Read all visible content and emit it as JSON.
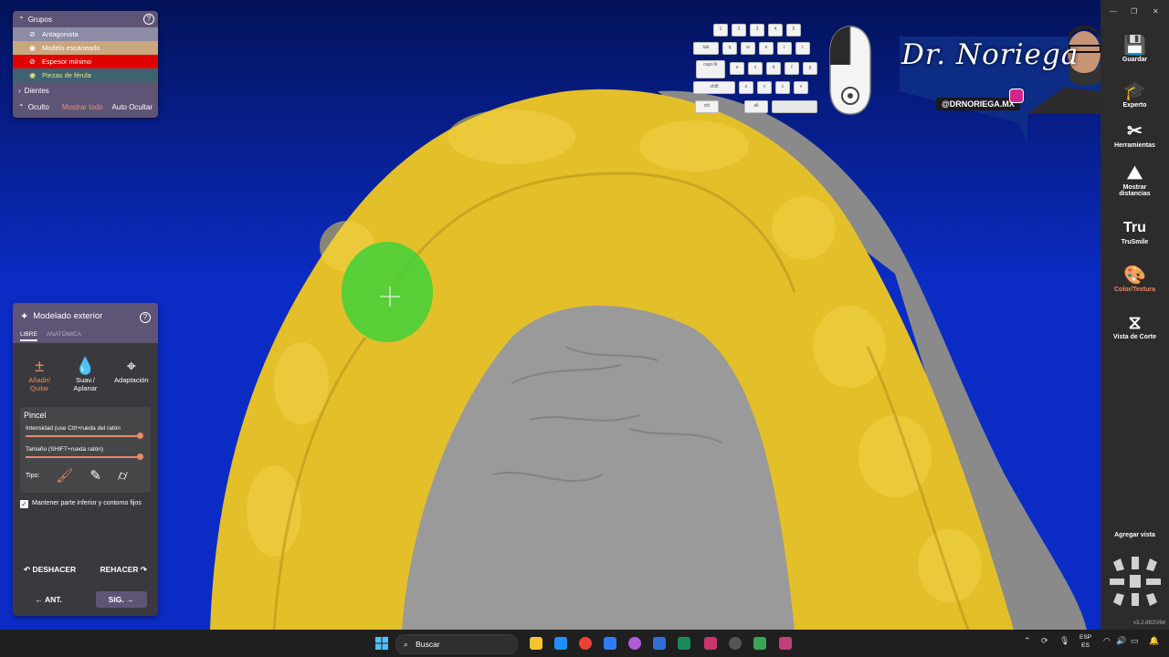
{
  "groups_panel": {
    "title": "Grupos",
    "rows": [
      {
        "label": "Antagonista"
      },
      {
        "label": "Modelo escaneado"
      },
      {
        "label": "Espesor mínimo"
      },
      {
        "label": "Piezas de férula"
      }
    ],
    "teeth_label": "Dientes",
    "hidden_label": "Oculto",
    "show_all": "Mostrar todo",
    "auto_hide": "Auto Ocultar"
  },
  "modelado_panel": {
    "title": "Modelado exterior",
    "tabs": [
      "LIBRE",
      "ANATÓMICA"
    ],
    "tools": [
      {
        "label_line1": "Añadir/",
        "label_line2": "Quitar",
        "icon": "add-remove-icon"
      },
      {
        "label_line1": "Suav./",
        "label_line2": "Aplanar",
        "icon": "drop-icon"
      },
      {
        "label_line1": "Adaptación",
        "label_line2": "",
        "icon": "adapt-icon"
      }
    ],
    "brush_title": "Pincel",
    "intensity_label": "Intensidad (use Ctrl+rueda del ratón",
    "size_label": "Tamaño (SHIFT+rueda ratón)",
    "intensity_value": 1.0,
    "size_value": 1.0,
    "type_label": "Tipo:",
    "keep_label": "Mantener parte inferior y contorno fijos",
    "undo": "DESHACER",
    "redo": "REHACER",
    "prev": "ANT.",
    "next": "SIG."
  },
  "right_toolbar": {
    "items": [
      {
        "label": "Guardar",
        "icon": "save-icon"
      },
      {
        "label": "Experto",
        "icon": "graduation-cap-icon"
      },
      {
        "label": "Herramientas",
        "icon": "tools-icon"
      },
      {
        "label": "Mostrar distancias",
        "icon": "distances-icon"
      },
      {
        "label": "TruSmile",
        "icon": "trusmile-icon"
      },
      {
        "label": "Color/Textura",
        "icon": "palette-icon"
      },
      {
        "label": "Vista de Corte",
        "icon": "cut-view-icon"
      }
    ],
    "add_view": "Agregar vista",
    "version": "v3.2-8820/64"
  },
  "keyboard_overlay": {
    "row1": [
      "1",
      "2",
      "3",
      "4",
      "5"
    ],
    "row2": [
      "tab",
      "q",
      "w",
      "e",
      "r",
      "t"
    ],
    "row3": [
      "caps lk",
      "a",
      "s",
      "d",
      "f",
      "g"
    ],
    "row4": [
      "shift",
      "z",
      "x",
      "c",
      "v"
    ],
    "row5": [
      "ctrl",
      "alt"
    ]
  },
  "branding": {
    "name": "Dr. Noriega",
    "handle": "@DRNORIEGA.MX"
  },
  "taskbar": {
    "search_placeholder": "Buscar",
    "lang_line1": "ESP",
    "lang_line2": "ES"
  },
  "colors": {
    "splint": "#e8c52b",
    "model": "#8f8f8f",
    "brush": "#40d13a",
    "accent": "#e98a66",
    "panel": "#5e5476"
  }
}
